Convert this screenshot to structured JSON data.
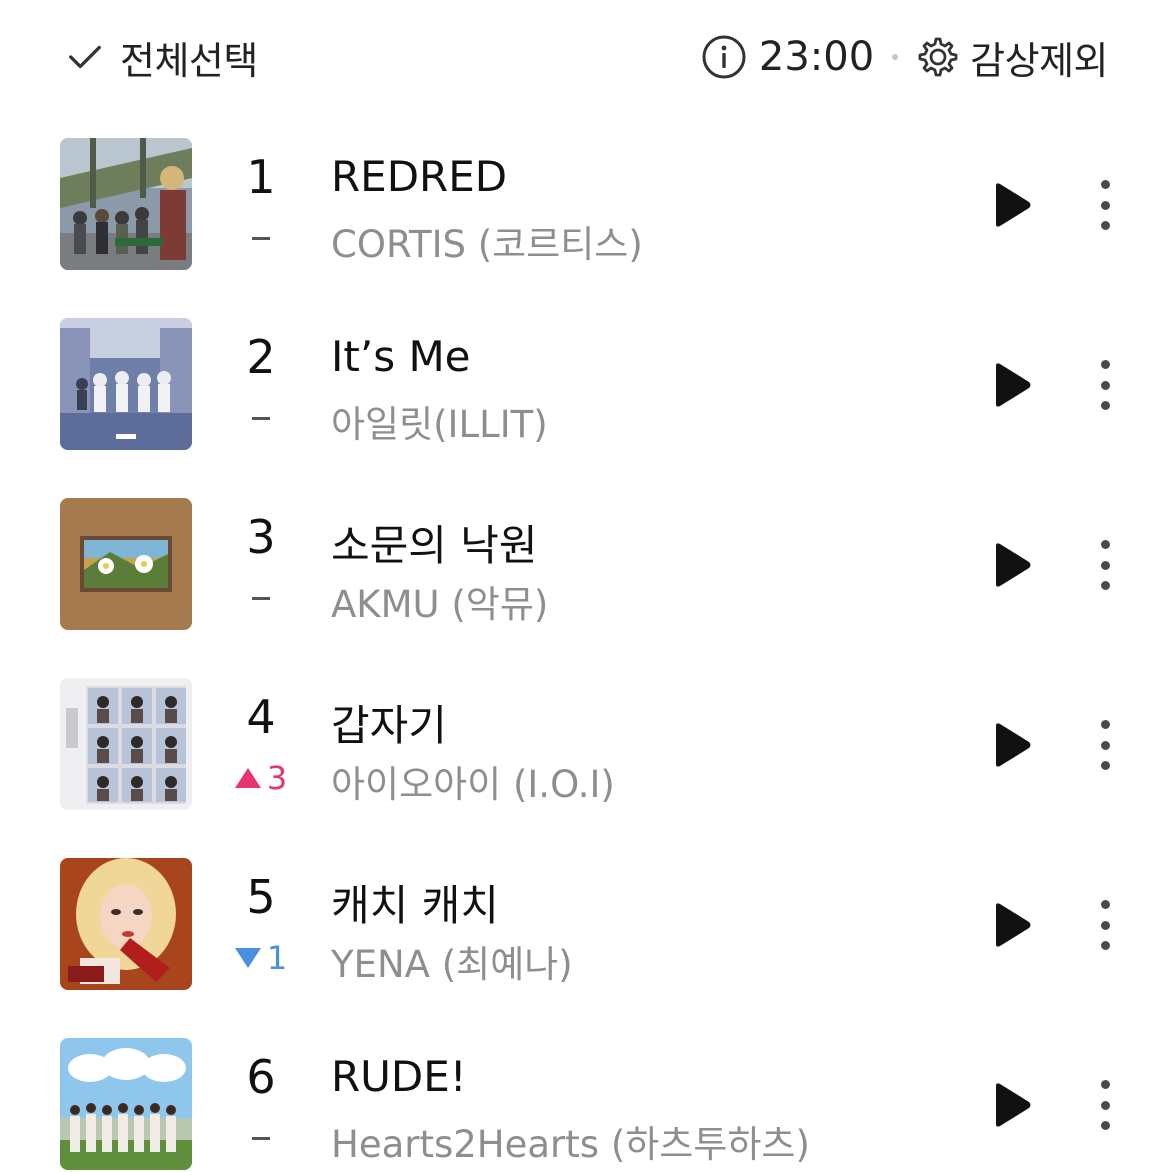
{
  "header": {
    "select_all_label": "전체선택",
    "time": "23:00",
    "exclude_label": "감상제외"
  },
  "colors": {
    "rank_up": "#e5366f",
    "rank_down": "#4a90e2",
    "artist_text": "#8e8e8e"
  },
  "tracks": [
    {
      "rank": "1",
      "change": {
        "type": "same",
        "value": ""
      },
      "title": "REDRED",
      "artist": "CORTIS (코르티스)",
      "cover_icon": "album-cover-cortis"
    },
    {
      "rank": "2",
      "change": {
        "type": "same",
        "value": ""
      },
      "title": "It’s Me",
      "artist": "아일릿(ILLIT)",
      "cover_icon": "album-cover-illit"
    },
    {
      "rank": "3",
      "change": {
        "type": "same",
        "value": ""
      },
      "title": "소문의 낙원",
      "artist": "AKMU (악뮤)",
      "cover_icon": "album-cover-akmu"
    },
    {
      "rank": "4",
      "change": {
        "type": "up",
        "value": "3"
      },
      "title": "갑자기",
      "artist": "아이오아이 (I.O.I)",
      "cover_icon": "album-cover-ioi"
    },
    {
      "rank": "5",
      "change": {
        "type": "down",
        "value": "1"
      },
      "title": "캐치 캐치",
      "artist": "YENA (최예나)",
      "cover_icon": "album-cover-yena"
    },
    {
      "rank": "6",
      "change": {
        "type": "same",
        "value": ""
      },
      "title": "RUDE!",
      "artist": "Hearts2Hearts (하츠투하츠)",
      "cover_icon": "album-cover-hearts2hearts"
    }
  ]
}
